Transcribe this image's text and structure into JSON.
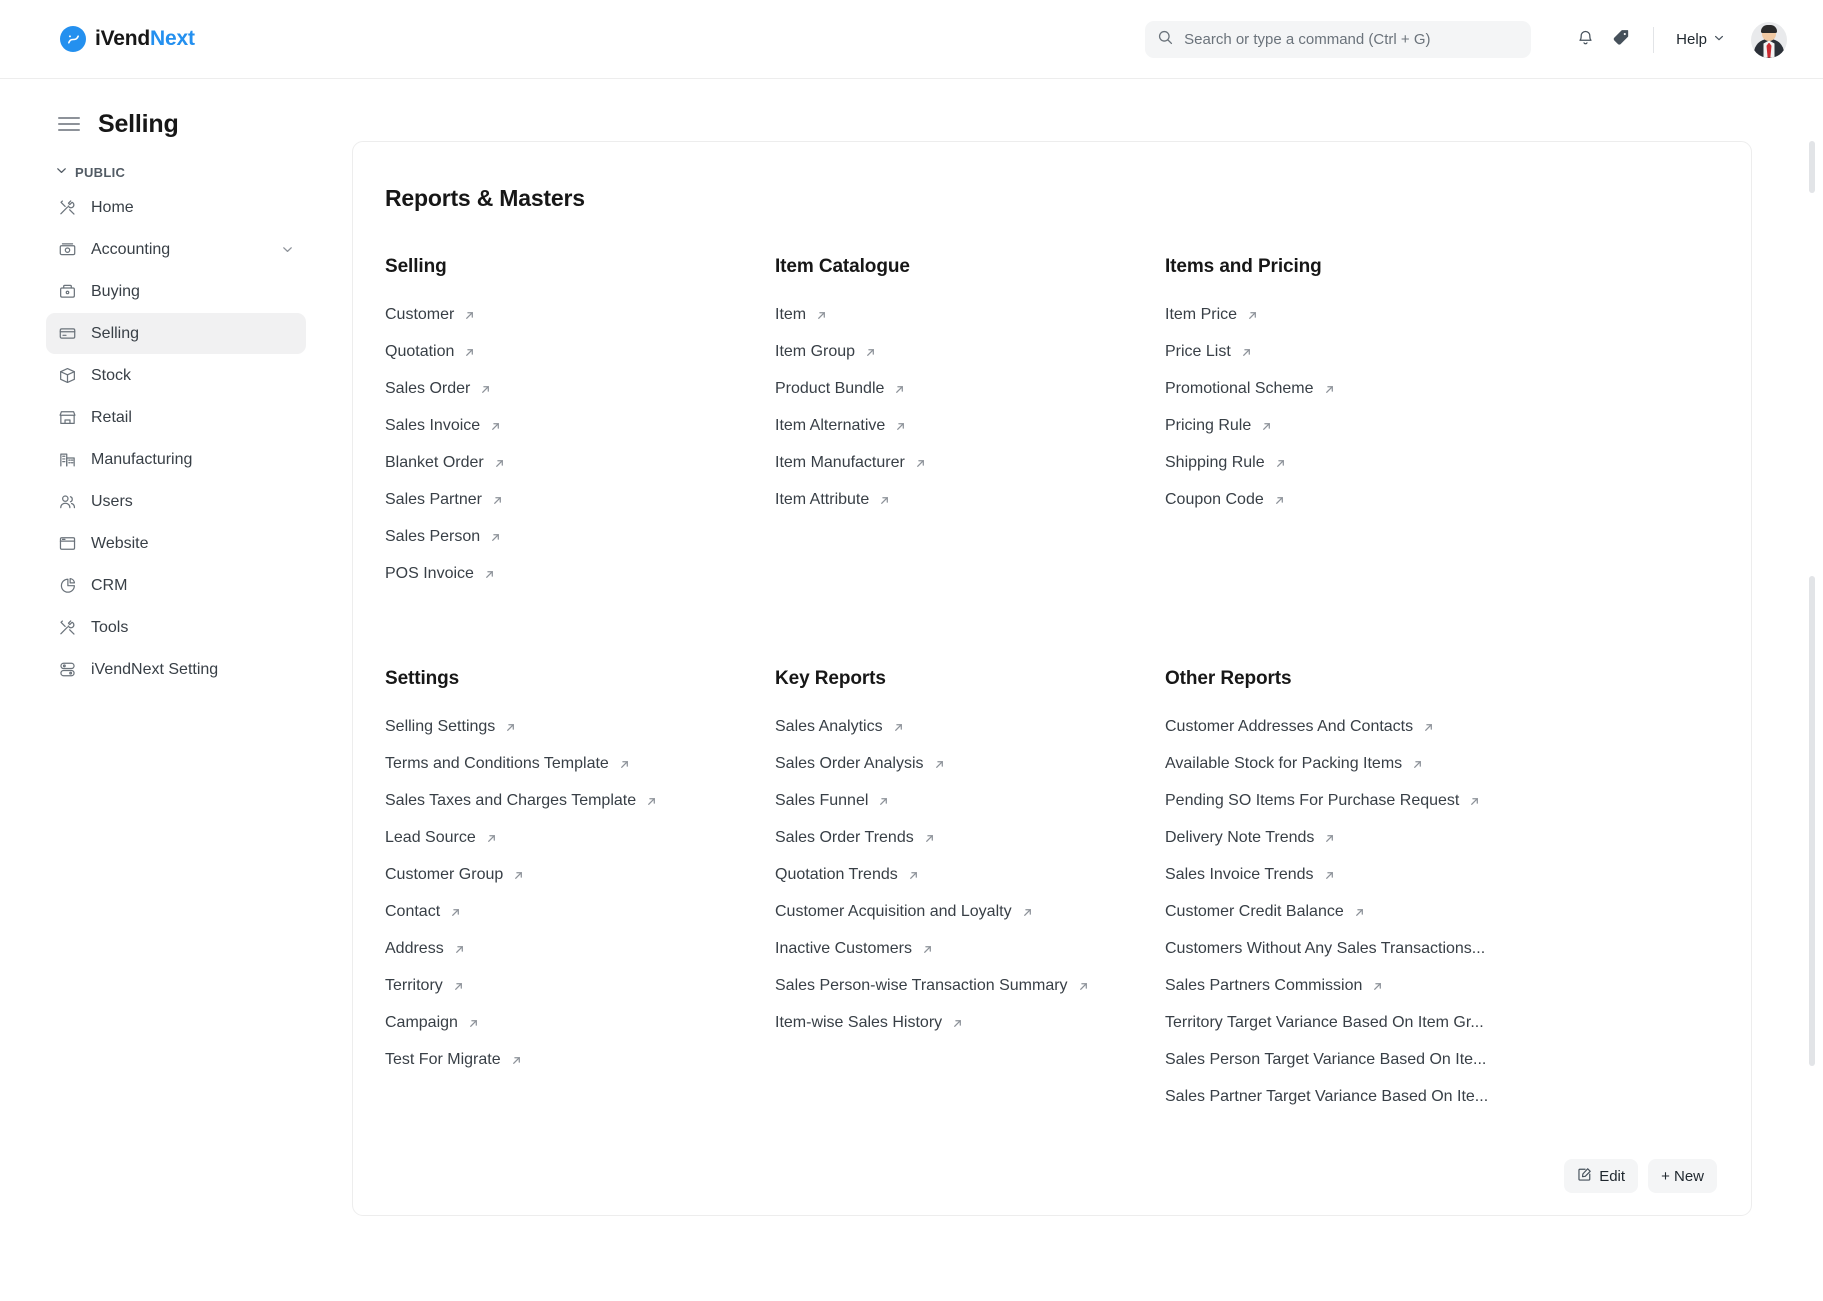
{
  "brand": {
    "name_dark": "iVend",
    "name_blue": "Next",
    "mark_glyph": "↗"
  },
  "topbar": {
    "search_placeholder": "Search or type a command (Ctrl + G)",
    "search_value": "",
    "help_label": "Help",
    "icons": {
      "search": "search-icon",
      "notifications": "bell-icon",
      "tags": "tag-icon",
      "chevron": "chevron-down-icon"
    }
  },
  "page": {
    "title": "Selling"
  },
  "sidebar": {
    "section_label": "PUBLIC",
    "items": [
      {
        "label": "Home",
        "icon": "tools-icon",
        "active": false,
        "expandable": false
      },
      {
        "label": "Accounting",
        "icon": "cash-icon",
        "active": false,
        "expandable": true
      },
      {
        "label": "Buying",
        "icon": "box-icon",
        "active": false,
        "expandable": false
      },
      {
        "label": "Selling",
        "icon": "card-icon",
        "active": true,
        "expandable": false
      },
      {
        "label": "Stock",
        "icon": "package-icon",
        "active": false,
        "expandable": false
      },
      {
        "label": "Retail",
        "icon": "store-icon",
        "active": false,
        "expandable": false
      },
      {
        "label": "Manufacturing",
        "icon": "factory-icon",
        "active": false,
        "expandable": false
      },
      {
        "label": "Users",
        "icon": "users-icon",
        "active": false,
        "expandable": false
      },
      {
        "label": "Website",
        "icon": "browser-icon",
        "active": false,
        "expandable": false
      },
      {
        "label": "CRM",
        "icon": "piechart-icon",
        "active": false,
        "expandable": false
      },
      {
        "label": "Tools",
        "icon": "tools-icon",
        "active": false,
        "expandable": false
      },
      {
        "label": "iVendNext Setting",
        "icon": "server-icon",
        "active": false,
        "expandable": false
      }
    ]
  },
  "workspace": {
    "title": "Reports & Masters",
    "columns": [
      {
        "heading": "Selling",
        "links": [
          {
            "label": "Customer",
            "external": true
          },
          {
            "label": "Quotation",
            "external": true
          },
          {
            "label": "Sales Order",
            "external": true
          },
          {
            "label": "Sales Invoice",
            "external": true
          },
          {
            "label": "Blanket Order",
            "external": true
          },
          {
            "label": "Sales Partner",
            "external": true
          },
          {
            "label": "Sales Person",
            "external": true
          },
          {
            "label": "POS Invoice",
            "external": true
          }
        ]
      },
      {
        "heading": "Item Catalogue",
        "links": [
          {
            "label": "Item",
            "external": true
          },
          {
            "label": "Item Group",
            "external": true
          },
          {
            "label": "Product Bundle",
            "external": true
          },
          {
            "label": "Item Alternative",
            "external": true
          },
          {
            "label": "Item Manufacturer",
            "external": true
          },
          {
            "label": "Item Attribute",
            "external": true
          }
        ]
      },
      {
        "heading": "Items and Pricing",
        "links": [
          {
            "label": "Item Price",
            "external": true
          },
          {
            "label": "Price List",
            "external": true
          },
          {
            "label": "Promotional Scheme",
            "external": true
          },
          {
            "label": "Pricing Rule",
            "external": true
          },
          {
            "label": "Shipping Rule",
            "external": true
          },
          {
            "label": "Coupon Code",
            "external": true
          }
        ]
      },
      {
        "heading": "Settings",
        "links": [
          {
            "label": "Selling Settings",
            "external": true
          },
          {
            "label": "Terms and Conditions Template",
            "external": true
          },
          {
            "label": "Sales Taxes and Charges Template",
            "external": true
          },
          {
            "label": "Lead Source",
            "external": true
          },
          {
            "label": "Customer Group",
            "external": true
          },
          {
            "label": "Contact",
            "external": true
          },
          {
            "label": "Address",
            "external": true
          },
          {
            "label": "Territory",
            "external": true
          },
          {
            "label": "Campaign",
            "external": true
          },
          {
            "label": "Test For Migrate",
            "external": true
          }
        ]
      },
      {
        "heading": "Key Reports",
        "links": [
          {
            "label": "Sales Analytics",
            "external": true
          },
          {
            "label": "Sales Order Analysis",
            "external": true
          },
          {
            "label": "Sales Funnel",
            "external": true
          },
          {
            "label": "Sales Order Trends",
            "external": true
          },
          {
            "label": "Quotation Trends",
            "external": true
          },
          {
            "label": "Customer Acquisition and Loyalty",
            "external": true
          },
          {
            "label": "Inactive Customers",
            "external": true
          },
          {
            "label": "Sales Person-wise Transaction Summary",
            "external": true
          },
          {
            "label": "Item-wise Sales History",
            "external": true
          }
        ]
      },
      {
        "heading": "Other Reports",
        "links": [
          {
            "label": "Customer Addresses And Contacts",
            "external": true
          },
          {
            "label": "Available Stock for Packing Items",
            "external": true
          },
          {
            "label": "Pending SO Items For Purchase Request",
            "external": true
          },
          {
            "label": "Delivery Note Trends",
            "external": true
          },
          {
            "label": "Sales Invoice Trends",
            "external": true
          },
          {
            "label": "Customer Credit Balance",
            "external": true
          },
          {
            "label": "Customers Without Any Sales Transactions...",
            "external": false
          },
          {
            "label": "Sales Partners Commission",
            "external": true
          },
          {
            "label": "Territory Target Variance Based On Item Gr...",
            "external": false
          },
          {
            "label": "Sales Person Target Variance Based On Ite...",
            "external": false
          },
          {
            "label": "Sales Partner Target Variance Based On Ite...",
            "external": false
          }
        ]
      }
    ],
    "actions": {
      "edit_label": "Edit",
      "new_label": "+ New"
    }
  },
  "colors": {
    "accent": "#2490ef",
    "text": "#1f272e",
    "muted": "#6b737b",
    "surface": "#f4f5f6",
    "border": "#ededed"
  }
}
